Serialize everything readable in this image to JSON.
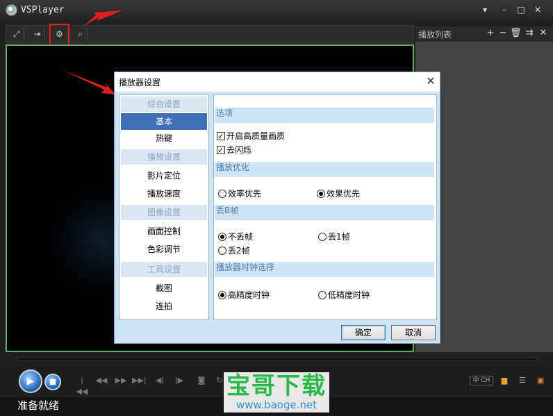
{
  "app": {
    "title": "VSPlayer"
  },
  "playlist": {
    "title": "播放列表"
  },
  "status": {
    "text": "准备就绪"
  },
  "controls": {
    "lang_label": "中 CH"
  },
  "watermark": {
    "title": "宝哥下载",
    "url": "www.baoge.net"
  },
  "dialog": {
    "title": "播放器设置",
    "categories": [
      {
        "label": "综合设置",
        "items": [
          "基本",
          "热键"
        ]
      },
      {
        "label": "播放设置",
        "items": [
          "影片定位",
          "播放速度"
        ]
      },
      {
        "label": "图像设置",
        "items": [
          "画面控制",
          "色彩调节"
        ]
      },
      {
        "label": "工具设置",
        "items": [
          "截图",
          "连拍"
        ]
      }
    ],
    "selected_item": "基本",
    "sections": {
      "options": {
        "title": "选项",
        "hq": "开启高质量画质",
        "deflicker": "去闪烁"
      },
      "playback": {
        "title": "播放优化",
        "efficiency": "效率优先",
        "effect": "效果优先",
        "selected": "效果优先"
      },
      "drop": {
        "title": "丢B帧",
        "none": "不丢帧",
        "one": "丢1帧",
        "two": "丢2帧",
        "selected": "不丢帧"
      },
      "clock": {
        "title": "播放器时钟选择",
        "high": "高精度时钟",
        "low": "低精度时钟",
        "selected": "高精度时钟"
      }
    },
    "ok_label": "确定",
    "cancel_label": "取消"
  },
  "colors": {
    "video_border": "#5fb35f",
    "highlight": "#e02020",
    "selected_item": "#3f6fb8",
    "section_text": "#4a7fb6"
  }
}
